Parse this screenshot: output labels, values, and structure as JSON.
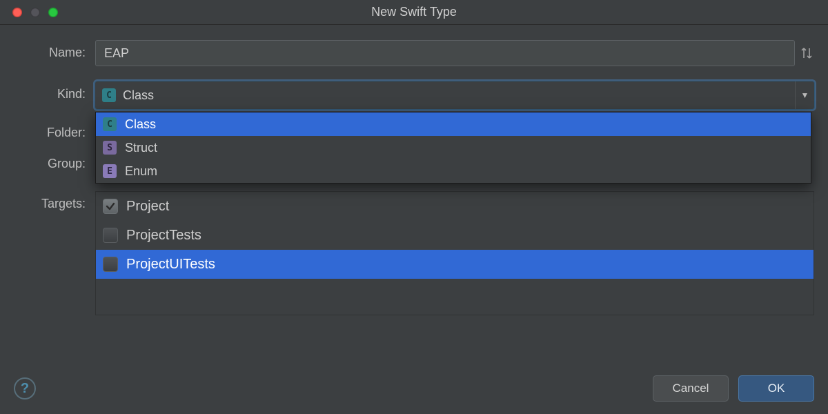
{
  "window": {
    "title": "New Swift Type"
  },
  "labels": {
    "name": "Name:",
    "kind": "Kind:",
    "folder": "Folder:",
    "group": "Group:",
    "targets": "Targets:"
  },
  "name": {
    "value": "EAP"
  },
  "kind": {
    "selected_badge": "C",
    "selected_label": "Class",
    "options": [
      {
        "badge": "C",
        "label": "Class",
        "selected": true
      },
      {
        "badge": "S",
        "label": "Struct",
        "selected": false
      },
      {
        "badge": "E",
        "label": "Enum",
        "selected": false
      }
    ]
  },
  "targets": {
    "items": [
      {
        "label": "Project",
        "checked": true,
        "selected": false
      },
      {
        "label": "ProjectTests",
        "checked": false,
        "selected": false
      },
      {
        "label": "ProjectUITests",
        "checked": false,
        "selected": true
      }
    ]
  },
  "buttons": {
    "cancel": "Cancel",
    "ok": "OK",
    "help": "?"
  }
}
